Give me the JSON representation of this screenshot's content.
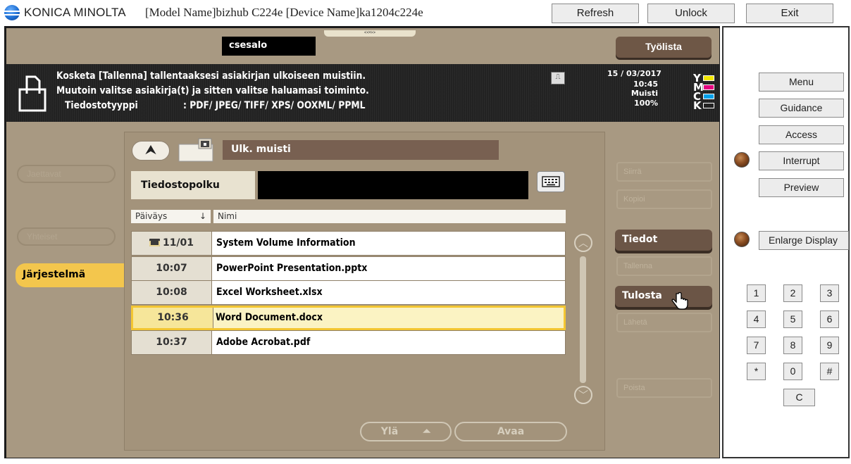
{
  "titlebar": {
    "brand": "KONICA MINOLTA",
    "model_info": "[Model Name]bizhub C224e [Device Name]ka1204c224e",
    "buttons": {
      "refresh": "Refresh",
      "unlock": "Unlock",
      "exit": "Exit"
    }
  },
  "header": {
    "user": "csesalo",
    "jobs_button": "Työlista",
    "handle_glyph": "<<•>>"
  },
  "info": {
    "line1": "Kosketa [Tallenna] tallentaaksesi asiakirjan ulkoiseen muistiin.",
    "line2": "Muutoin valitse asiakirja(t) ja sitten valitse haluamasi toiminto.",
    "type_label": "Tiedostotyyppi",
    "type_value": ": PDF/ JPEG/ TIFF/ XPS/ OOXML/ PPML",
    "date": "15 / 03/2017",
    "time": "10:45",
    "memory_label": "Muisti",
    "memory_value": "100%",
    "toner": [
      {
        "letter": "Y",
        "color": "#f2e600"
      },
      {
        "letter": "M",
        "color": "#e4007f"
      },
      {
        "letter": "C",
        "color": "#00a0e9"
      },
      {
        "letter": "K",
        "color": "#222222"
      }
    ]
  },
  "left_tabs": {
    "ghost1": "Jaettavat",
    "ghost2": "Yhteiset",
    "system": "Järjestelmä"
  },
  "browser": {
    "up_glyph": "⮝",
    "title": "Ulk. muisti",
    "path_label": "Tiedostopolku",
    "path_value": "",
    "col_date": "Päiväys",
    "col_sort": "↓",
    "col_name": "Nimi",
    "rows": [
      {
        "date": "11/01",
        "name": "System Volume Information",
        "folder": true
      },
      {
        "date": "10:07",
        "name": "PowerPoint Presentation.pptx"
      },
      {
        "date": "10:08",
        "name": "Excel Worksheet.xlsx"
      },
      {
        "date": "10:36",
        "name": "Word Document.docx",
        "selected": true
      },
      {
        "date": "10:37",
        "name": "Adobe Acrobat.pdf"
      }
    ],
    "up_level": "Ylä",
    "open": "Avaa"
  },
  "actions": {
    "ghost_top1": "Siirrä",
    "ghost_top2": "Kopioi",
    "info": "Tiedot",
    "ghost_save": "Tallenna",
    "print": "Tulosta",
    "ghost_send": "Lähetä",
    "ghost_bottom": "Poista"
  },
  "side_panel": {
    "menu": "Menu",
    "guidance": "Guidance",
    "access": "Access",
    "interrupt": "Interrupt",
    "preview": "Preview",
    "enlarge": "Enlarge Display",
    "keypad": [
      "1",
      "2",
      "3",
      "4",
      "5",
      "6",
      "7",
      "8",
      "9",
      "*",
      "0",
      "#"
    ],
    "clear": "C"
  }
}
